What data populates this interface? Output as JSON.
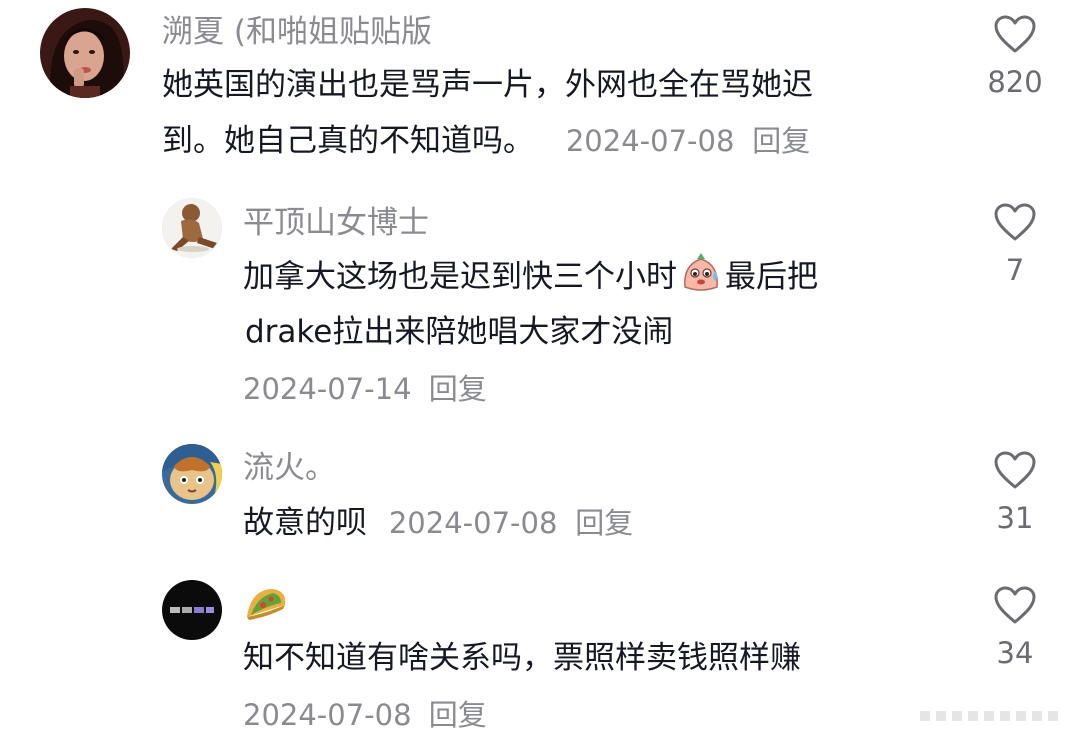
{
  "comments": [
    {
      "username": "溯夏 (和啪姐贴贴版",
      "line1": "她英国的演出也是骂声一片，外网也全在骂她迟",
      "line2": "到。她自己真的不知道吗。",
      "date": "2024-07-08",
      "reply": "回复",
      "likes": "820",
      "avatar_color": "#5a2a22"
    },
    {
      "username": "平顶山女博士",
      "line1a": "加拿大这场也是迟到快三个小时",
      "line1b": "最后把",
      "line2": "drake拉出来陪她唱大家才没闹",
      "date": "2024-07-14",
      "reply": "回复",
      "likes": "7",
      "emoji": "sweating-face-emoji",
      "avatar_color": "#a5744a"
    },
    {
      "username": "流火。",
      "line1": "故意的呗",
      "date": "2024-07-08",
      "reply": "回复",
      "likes": "31",
      "avatar_color": "#d6b07a"
    },
    {
      "username_icon": "taco-icon",
      "line1": "知不知道有啥关系吗，票照样卖钱照样赚",
      "date": "2024-07-08",
      "reply": "回复",
      "likes": "34",
      "avatar_color": "#0b0b0b"
    }
  ],
  "colors": {
    "text": "#161823",
    "secondary": "#8a8b91",
    "heart_stroke": "#6b6c72"
  }
}
